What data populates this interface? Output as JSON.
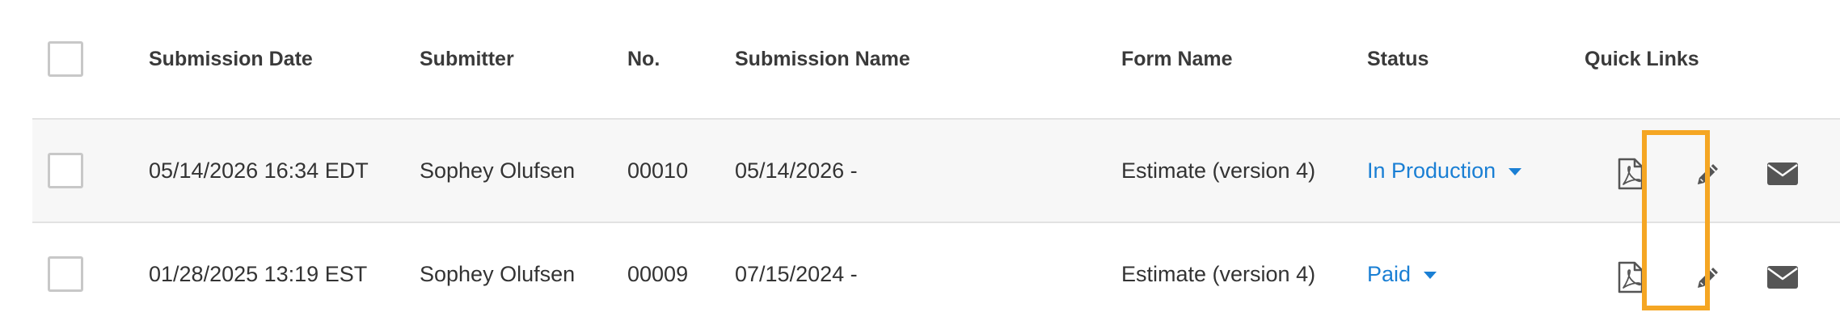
{
  "table": {
    "headers": {
      "submission_date": "Submission Date",
      "submitter": "Submitter",
      "no": "No.",
      "submission_name": "Submission Name",
      "form_name": "Form Name",
      "status": "Status",
      "quick_links": "Quick Links"
    },
    "rows": [
      {
        "submission_date": "05/14/2026 16:34 EDT",
        "submitter": "Sophey Olufsen",
        "no": "00010",
        "submission_name": "05/14/2026 -",
        "form_name": "Estimate (version 4)",
        "status": "In Production"
      },
      {
        "submission_date": "01/28/2025 13:19 EST",
        "submitter": "Sophey Olufsen",
        "no": "00009",
        "submission_name": "07/15/2024 -",
        "form_name": "Estimate (version 4)",
        "status": "Paid"
      }
    ]
  },
  "quick_link_icons": [
    "pdf-icon",
    "pencil-icon",
    "envelope-icon"
  ],
  "colors": {
    "link": "#1a7fd4",
    "highlight": "#f5a623",
    "row_alt_bg": "#f7f7f7",
    "icon": "#555555"
  }
}
